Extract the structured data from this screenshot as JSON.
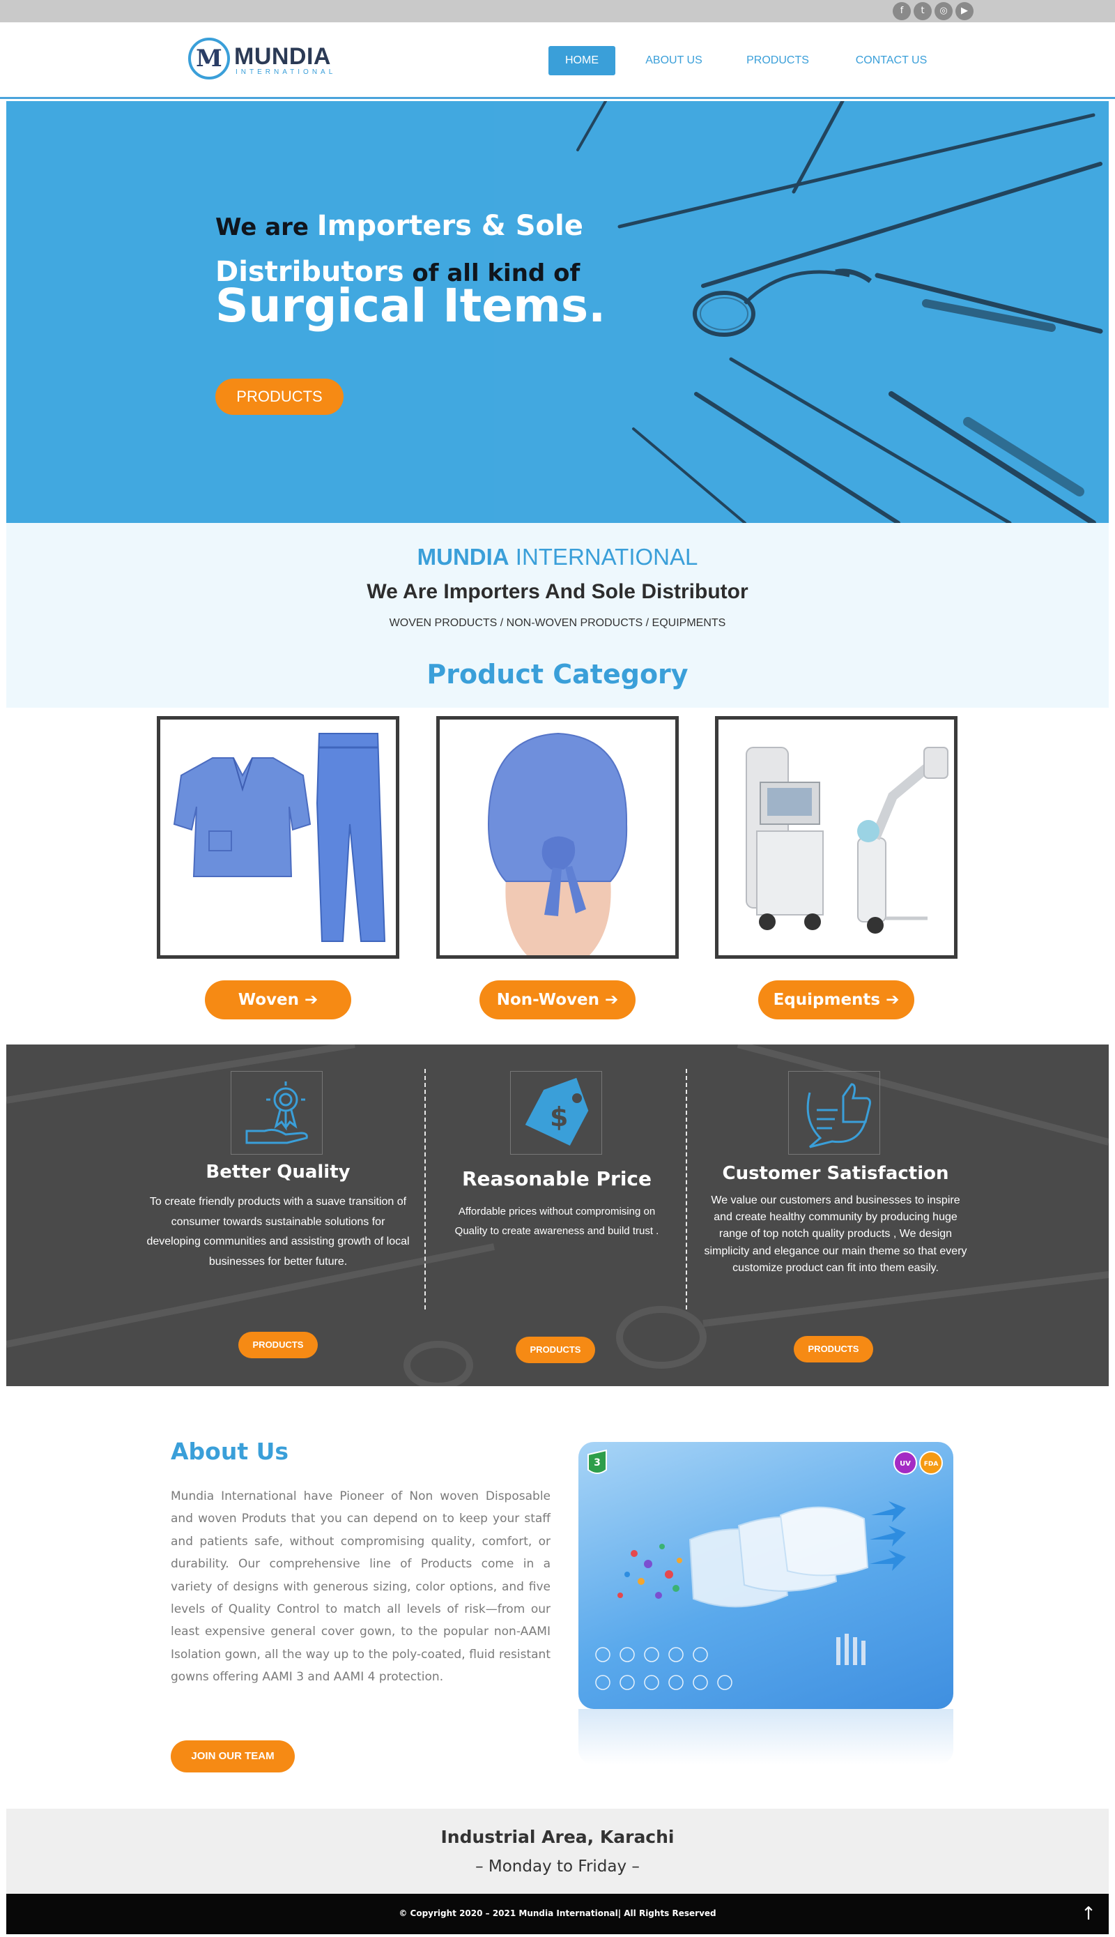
{
  "social": {
    "facebook_glyph": "f",
    "twitter_glyph": "t",
    "instagram_glyph": "◎",
    "youtube_glyph": "▶"
  },
  "brand": {
    "logo_letter": "M",
    "name": "MUNDIA",
    "sub": "INTERNATIONAL"
  },
  "nav": {
    "items": [
      {
        "label": "HOME",
        "active": true
      },
      {
        "label": "ABOUT US"
      },
      {
        "label": "PRODUCTS"
      },
      {
        "label": "CONTACT US"
      }
    ]
  },
  "hero": {
    "line1_dark": "We are ",
    "line1_light": "Importers & Sole",
    "line2_light": "Distributors",
    "line2_dark": " of all kind of",
    "big": "Surgical Items.",
    "button": "PRODUCTS"
  },
  "intro": {
    "brand_bold": "MUNDIA",
    "brand_rest": " INTERNATIONAL",
    "heading": "We Are Importers And Sole Distributor",
    "tags": "WOVEN PRODUCTS / NON-WOVEN PRODUCTS / EQUIPMENTS",
    "category_title": "Product Category"
  },
  "categories": [
    {
      "label": "Woven"
    },
    {
      "label": "Non-Woven"
    },
    {
      "label": "Equipments"
    }
  ],
  "features": [
    {
      "title": "Better Quality",
      "text": "To create friendly products with a suave transition of consumer towards sustainable solutions for developing communities and assisting growth of local businesses for better future.",
      "button": "PRODUCTS"
    },
    {
      "title": "Reasonable Price",
      "text": "Affordable prices without compromising on Quality to create awareness and build trust .",
      "button": "PRODUCTS"
    },
    {
      "title": "Customer Satisfaction",
      "text": "We value our customers and businesses to inspire and create healthy community by producing huge range of top notch quality products , We design simplicity and elegance our main theme so that every customize product can fit into them easily.",
      "button": "PRODUCTS"
    }
  ],
  "about": {
    "heading": "About Us",
    "text": "Mundia International have Pioneer of Non woven Disposable and woven Produts that you can depend on to keep your staff and patients safe, without compromising quality, comfort, or durability. Our comprehensive line of Products come in a variety of designs with generous sizing, color options, and five levels of Quality Control to match all levels of risk—from our least expensive general cover gown, to the popular non-AAMI Isolation gown, all the way up to the poly-coated, fluid resistant gowns offering AAMI 3 and AAMI 4 protection.",
    "button": "JOIN OUR TEAM",
    "badge_layers": "3",
    "badge_uv": "UV",
    "badge_fda": "FDA"
  },
  "footer": {
    "address": "Industrial Area, Karachi",
    "hours": "– Monday to Friday –",
    "copyright": "© Copyright 2020 – 2021 Mundia International| All Rights Reserved",
    "to_top": "↑"
  },
  "colors": {
    "accent_blue": "#3a9fd9",
    "hero_blue": "#42a8e0",
    "orange": "#f68a14",
    "feature_bg": "#4a4a4a"
  }
}
